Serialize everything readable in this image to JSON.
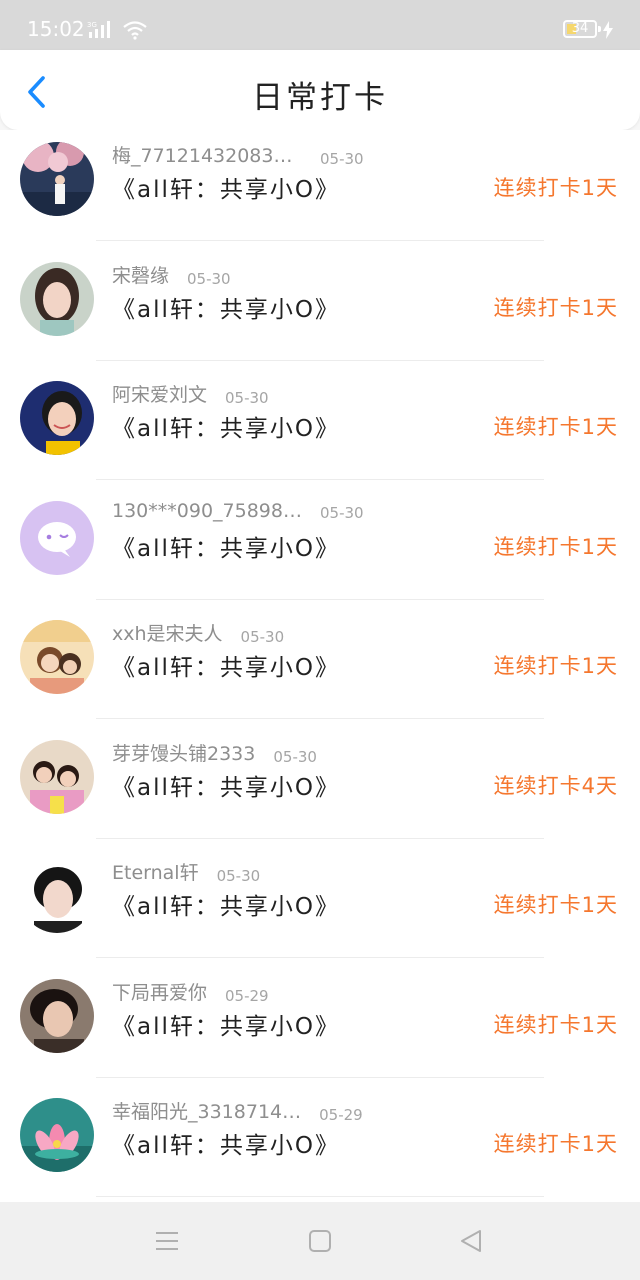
{
  "status_bar": {
    "time": "15:02",
    "network": "3G",
    "battery_level": "34",
    "battery_fraction": 0.34,
    "icons": [
      "signal-icon",
      "wifi-icon",
      "battery-icon",
      "charging-icon"
    ]
  },
  "header": {
    "title": "日常打卡",
    "back_icon": "chevron-left-icon"
  },
  "checkins": [
    {
      "username": "梅_771214320832…",
      "date": "05-30",
      "title": "《all轩：共享小O》",
      "streak": "连续打卡1天",
      "avatar": "avatar-blossom-girl"
    },
    {
      "username": "宋磬缘",
      "date": "05-30",
      "title": "《all轩：共享小O》",
      "streak": "连续打卡1天",
      "avatar": "avatar-portrait-girl"
    },
    {
      "username": "阿宋爱刘文",
      "date": "05-30",
      "title": "《all轩：共享小O》",
      "streak": "连续打卡1天",
      "avatar": "avatar-smiling-girl"
    },
    {
      "username": "130***090_758987…",
      "date": "05-30",
      "title": "《all轩：共享小O》",
      "streak": "连续打卡1天",
      "avatar": "avatar-default-chat"
    },
    {
      "username": "xxh是宋夫人",
      "date": "05-30",
      "title": "《all轩：共享小O》",
      "streak": "连续打卡1天",
      "avatar": "avatar-illustration"
    },
    {
      "username": "芽芽馒头铺2333",
      "date": "05-30",
      "title": "《all轩：共享小O》",
      "streak": "连续打卡4天",
      "avatar": "avatar-two-boys"
    },
    {
      "username": "Eternal轩",
      "date": "05-30",
      "title": "《all轩：共享小O》",
      "streak": "连续打卡1天",
      "avatar": "avatar-boy-dark-hair"
    },
    {
      "username": "下局再爱你",
      "date": "05-29",
      "title": "《all轩：共享小O》",
      "streak": "连续打卡1天",
      "avatar": "avatar-boy-portrait"
    },
    {
      "username": "幸福阳光_3318714…",
      "date": "05-29",
      "title": "《all轩：共享小O》",
      "streak": "连续打卡1天",
      "avatar": "avatar-lotus"
    }
  ],
  "nav_bar": {
    "icons": [
      "menu-icon",
      "home-icon",
      "back-icon"
    ]
  },
  "colors": {
    "accent_blue": "#1a8cff",
    "streak_orange": "#f5772e",
    "status_bar_bg": "#d9d9d9"
  }
}
